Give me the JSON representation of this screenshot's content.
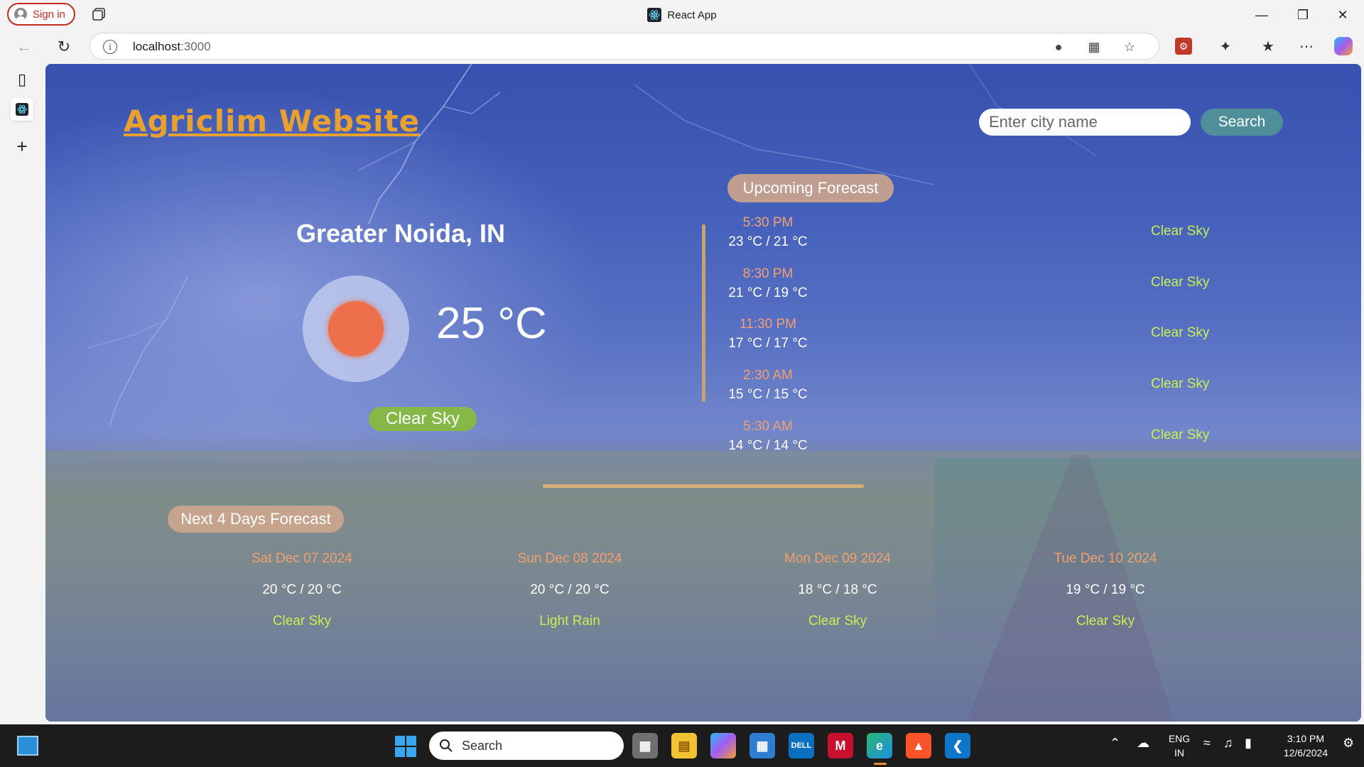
{
  "browser": {
    "sign_in": "Sign in",
    "tab_title": "React App",
    "url_host": "localhost",
    "url_port": ":3000"
  },
  "page": {
    "site_title": "Agriclim Website",
    "search": {
      "placeholder": "Enter city name",
      "button": "Search"
    },
    "current": {
      "city": "Greater Noida, IN",
      "temperature": "25 °C",
      "condition": "Clear Sky",
      "icon": "sun-icon"
    },
    "upcoming": {
      "title": "Upcoming Forecast",
      "items": [
        {
          "time": "5:30 PM",
          "temp": "23 °C / 21 °C",
          "condition": "Clear Sky"
        },
        {
          "time": "8:30 PM",
          "temp": "21 °C / 19 °C",
          "condition": "Clear Sky"
        },
        {
          "time": "11:30 PM",
          "temp": "17 °C / 17 °C",
          "condition": "Clear Sky"
        },
        {
          "time": "2:30 AM",
          "temp": "15 °C / 15 °C",
          "condition": "Clear Sky"
        },
        {
          "time": "5:30 AM",
          "temp": "14 °C / 14 °C",
          "condition": "Clear Sky"
        }
      ]
    },
    "next_days": {
      "title": "Next 4 Days Forecast",
      "items": [
        {
          "date": "Sat Dec 07 2024",
          "temp": "20 °C / 20 °C",
          "condition": "Clear Sky"
        },
        {
          "date": "Sun Dec 08 2024",
          "temp": "20 °C / 20 °C",
          "condition": "Light Rain"
        },
        {
          "date": "Mon Dec 09 2024",
          "temp": "18 °C / 18 °C",
          "condition": "Clear Sky"
        },
        {
          "date": "Tue Dec 10 2024",
          "temp": "19 °C / 19 °C",
          "condition": "Clear Sky"
        }
      ]
    }
  },
  "taskbar": {
    "search": "Search",
    "lang_top": "ENG",
    "lang_bottom": "IN",
    "time": "3:10 PM",
    "date": "12/6/2024"
  },
  "colors": {
    "title_orange": "#e8a030",
    "condition_green": "#86b847",
    "forecast_time": "#f0a070",
    "forecast_condition": "#c8f050"
  }
}
